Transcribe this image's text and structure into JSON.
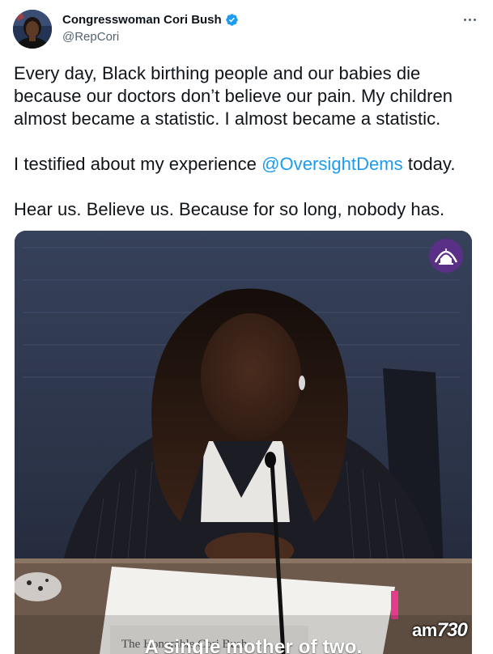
{
  "author": {
    "display_name": "Congresswoman Cori Bush",
    "handle": "@RepCori",
    "verified": true
  },
  "tweet": {
    "line1": "Every day, Black birthing people and our babies die because our doctors don’t believe our pain. My children almost became a statistic. I almost became a statistic.",
    "line2_before": "I testified about my experience ",
    "line2_mention": "@OversightDems",
    "line2_after": " today.",
    "line3": "Hear us. Believe us. Because for so long, nobody has."
  },
  "media": {
    "caption": "A single mother of two.",
    "placard_text": "The Honorable Cori Bush"
  },
  "watermark": {
    "prefix": "am",
    "number": "730"
  },
  "colors": {
    "link": "#1d9bf0",
    "text": "#0f1419",
    "secondary": "#536471",
    "verified_badge": "#1d9bf0",
    "logo_badge": "#5a2f86"
  },
  "icons": {
    "verified": "verified-badge-icon",
    "more": "more-options-icon",
    "capitol_logo": "capitol-logo-icon"
  }
}
